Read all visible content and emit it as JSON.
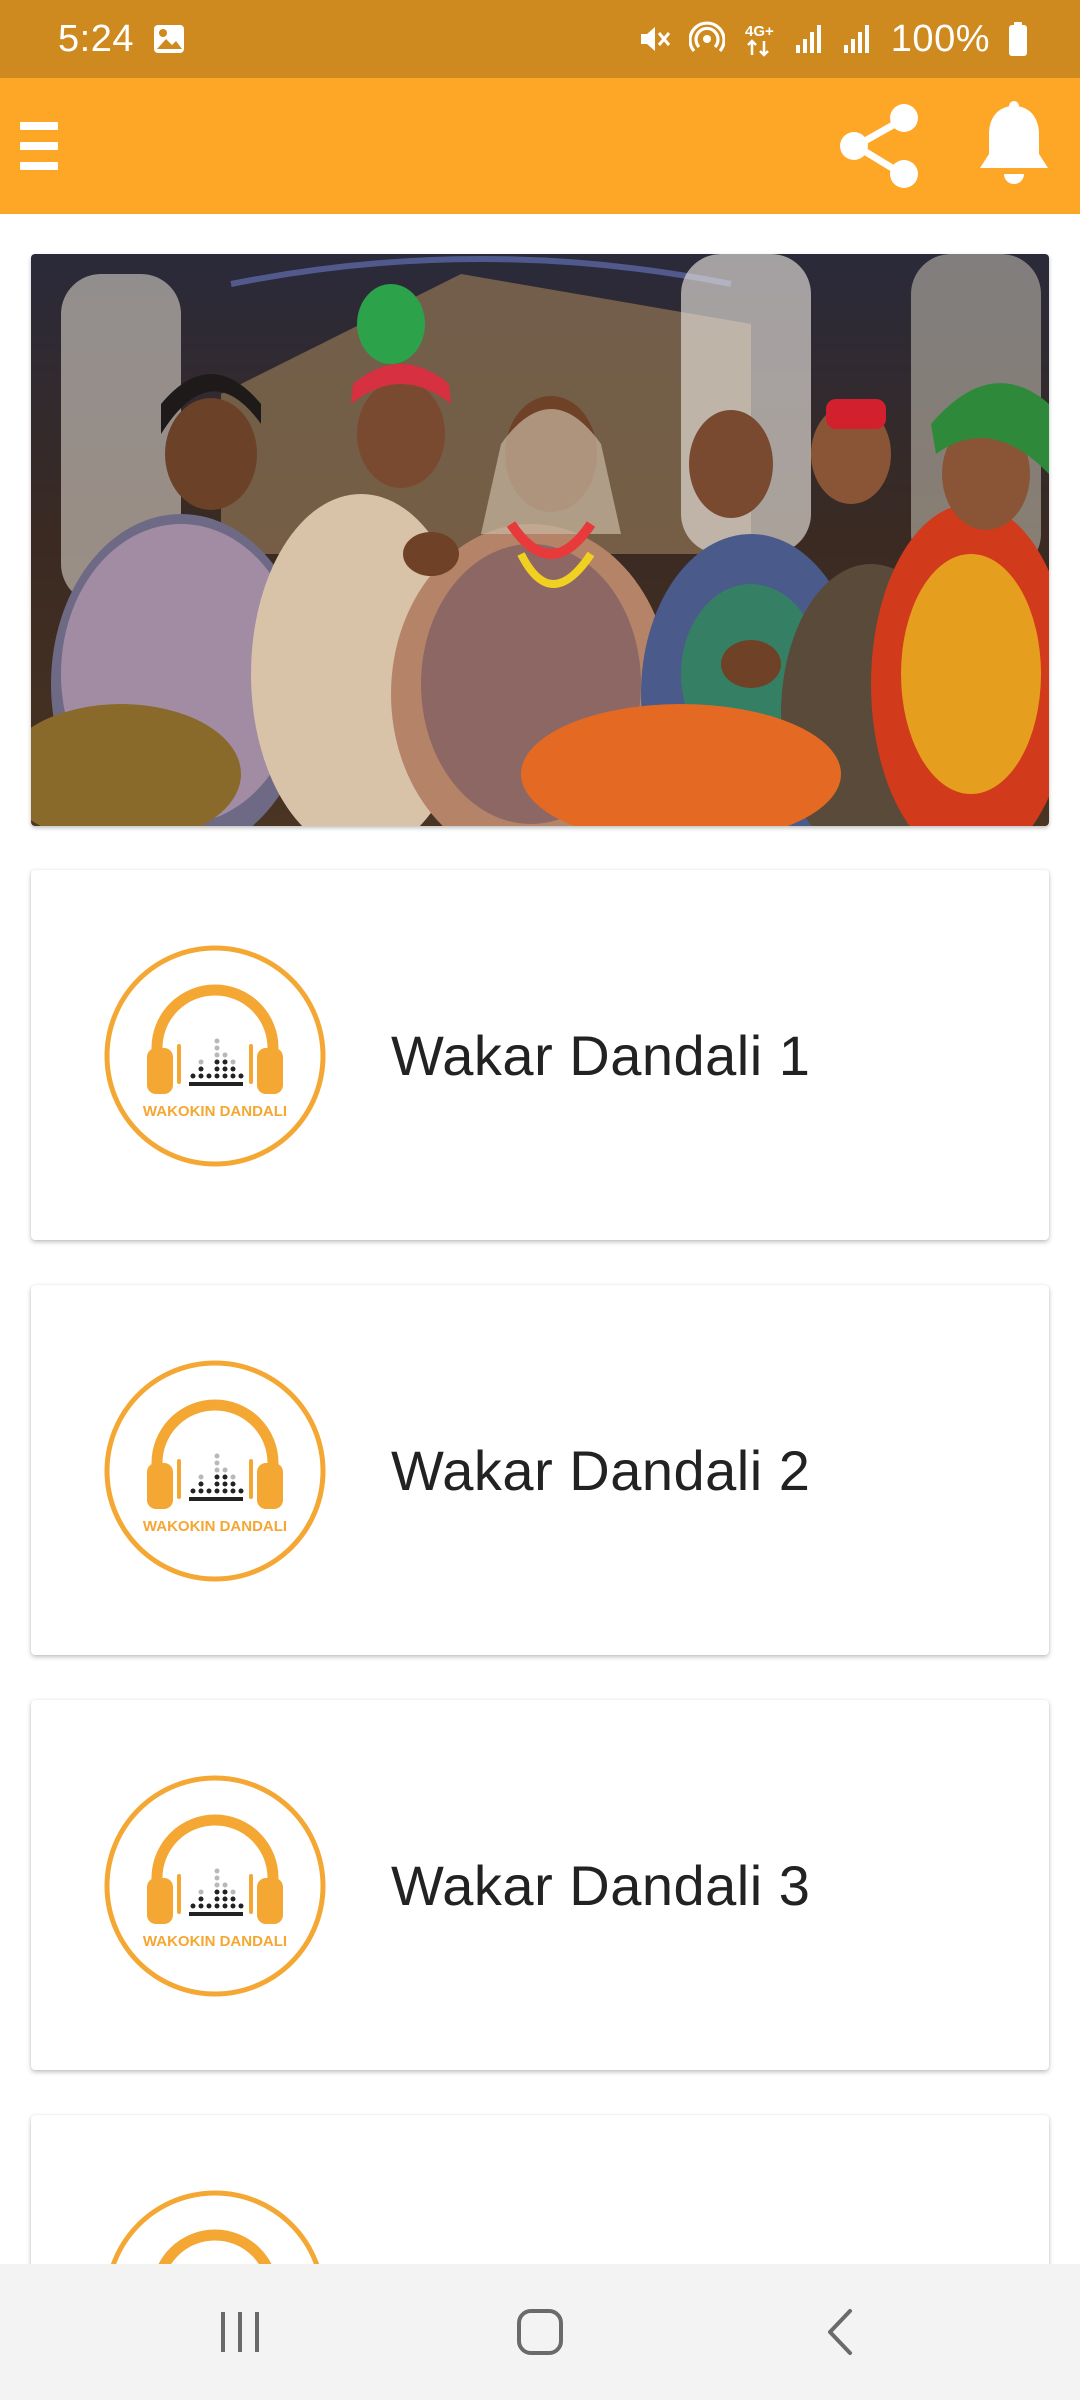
{
  "status_bar": {
    "time": "5:24",
    "battery": "100%",
    "icons": [
      "gallery-icon",
      "mute-icon",
      "hotspot-icon",
      "4g-icon",
      "signal-icon",
      "signal-icon",
      "battery-icon"
    ]
  },
  "app_bar": {
    "color": "#fea626",
    "actions": [
      "menu-icon",
      "share-icon",
      "bell-icon"
    ]
  },
  "banner": {
    "description_icon": "photo-banner"
  },
  "items": [
    {
      "title": "Wakar Dandali 1",
      "logo_text": "WAKOKIN DANDALI"
    },
    {
      "title": "Wakar Dandali 2",
      "logo_text": "WAKOKIN DANDALI"
    },
    {
      "title": "Wakar Dandali 3",
      "logo_text": "WAKOKIN DANDALI"
    },
    {
      "title": "",
      "logo_text": ""
    }
  ],
  "colors": {
    "status_bar": "#cf8a1f",
    "accent": "#fea626",
    "logo_orange": "#f4a733"
  },
  "nav_bar": {
    "buttons": [
      "recents-icon",
      "home-icon",
      "back-icon"
    ]
  }
}
